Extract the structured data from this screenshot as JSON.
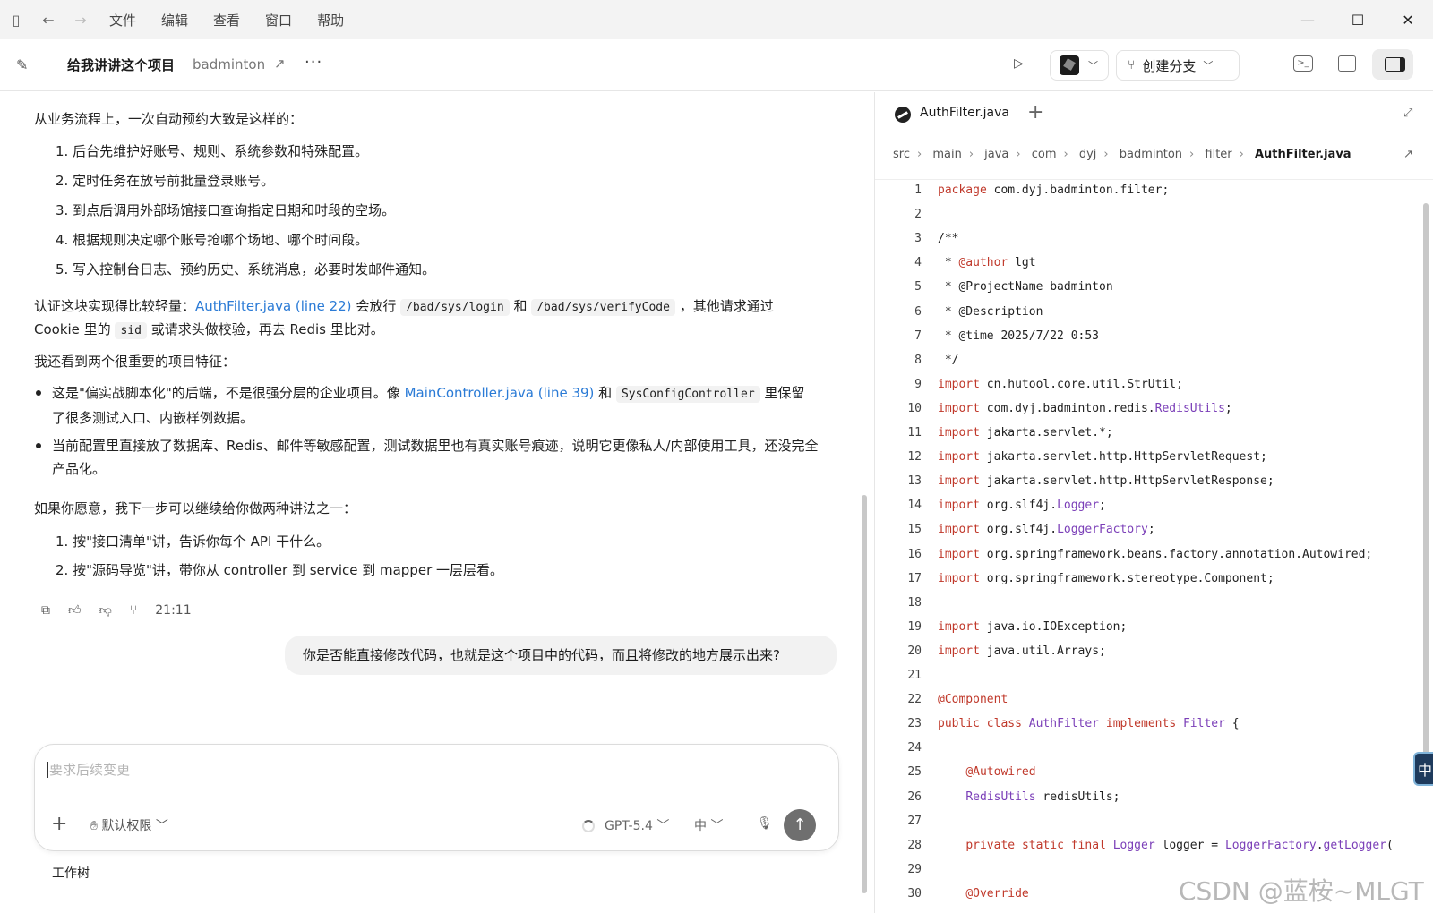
{
  "menu": [
    "文件",
    "编辑",
    "查看",
    "窗口",
    "帮助"
  ],
  "header": {
    "title": "给我讲讲这个项目",
    "project": "badminton",
    "branch_button": "创建分支"
  },
  "chat": {
    "intro": "从业务流程上，一次自动预约大致是这样的：",
    "flow_steps": [
      "1. 后台先维护好账号、规则、系统参数和特殊配置。",
      "2. 定时任务在放号前批量登录账号。",
      "3. 到点后调用外部场馆接口查询指定日期和时段的空场。",
      "4. 根据规则决定哪个账号抢哪个场地、哪个时间段。",
      "5. 写入控制台日志、预约历史、系统消息，必要时发邮件通知。"
    ],
    "auth": {
      "prefix": "认证这块实现得比较轻量：",
      "link": "AuthFilter.java (line 22)",
      "mid1": " 会放行 ",
      "code1": "/bad/sys/login",
      "and": " 和 ",
      "code2": "/bad/sys/verifyCode",
      "mid2": " ，其他请求通过",
      "line2_prefix": "Cookie 里的 ",
      "code3": "sid",
      "line2_suffix": " 或请求头做校验，再去 Redis 里比对。"
    },
    "features_intro": "我还看到两个很重要的项目特征：",
    "feature1": {
      "prefix": "这是\"偏实战脚本化\"的后端，不是很强分层的企业项目。像 ",
      "link": "MainController.java (line 39)",
      "and": " 和 ",
      "code": "SysConfigController",
      "suffix": " 里保留",
      "line2": "了很多测试入口、内嵌样例数据。"
    },
    "feature2": "当前配置里直接放了数据库、Redis、邮件等敏感配置，测试数据里也有真实账号痕迹，说明它更像私人/内部使用工具，还没完全产品化。",
    "next_intro": "如果你愿意，我下一步可以继续给你做两种讲法之一：",
    "next_steps": [
      "1. 按\"接口清单\"讲，告诉你每个 API 干什么。",
      "2. 按\"源码导览\"讲，带你从 controller 到 service 到 mapper 一层层看。"
    ],
    "timestamp": "21:11",
    "user_message": "你是否能直接修改代码，也就是这个项目中的代码，而且将修改的地方展示出来?"
  },
  "composer": {
    "placeholder": "要求后续变更",
    "permission": "默认权限",
    "model": "GPT-5.4",
    "lang": "中"
  },
  "worktree": "工作树",
  "editor": {
    "tab": "AuthFilter.java",
    "breadcrumb": [
      "src",
      "main",
      "java",
      "com",
      "dyj",
      "badminton",
      "filter",
      "AuthFilter.java"
    ]
  },
  "code_lines": [
    "package com.dyj.badminton.filter;",
    "",
    "/**",
    " * @author lgt",
    " * @ProjectName badminton",
    " * @Description",
    " * @time 2025/7/22 0:53",
    " */",
    "import cn.hutool.core.util.StrUtil;",
    "import com.dyj.badminton.redis.RedisUtils;",
    "import jakarta.servlet.*;",
    "import jakarta.servlet.http.HttpServletRequest;",
    "import jakarta.servlet.http.HttpServletResponse;",
    "import org.slf4j.Logger;",
    "import org.slf4j.LoggerFactory;",
    "import org.springframework.beans.factory.annotation.Autowired;",
    "import org.springframework.stereotype.Component;",
    "",
    "import java.io.IOException;",
    "import java.util.Arrays;",
    "",
    "@Component",
    "public class AuthFilter implements Filter {",
    "",
    "    @Autowired",
    "    RedisUtils redisUtils;",
    "",
    "    private static final Logger logger = LoggerFactory.getLogger(",
    "",
    "    @Override"
  ],
  "ime_indicator": "中",
  "watermark": "CSDN @蓝桉~MLGT"
}
